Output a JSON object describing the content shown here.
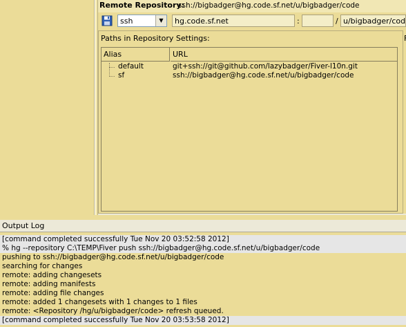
{
  "remote_repository": {
    "label": "Remote Repository:",
    "url": "ssh://bigbadger@hg.code.sf.net/u/bigbadger/code",
    "scheme": "ssh",
    "host": "hg.code.sf.net",
    "port_separator": ":",
    "port": "",
    "path_separator": "/",
    "path": "u/bigbadger/code"
  },
  "paths_panel": {
    "title": "Paths in Repository Settings:",
    "right_label": "F",
    "columns": [
      "Alias",
      "URL"
    ],
    "rows": [
      {
        "alias": "default",
        "url": "git+ssh://git@github.com/lazybadger/Fiver-l10n.git"
      },
      {
        "alias": "sf",
        "url": "ssh://bigbadger@hg.code.sf.net/u/bigbadger/code"
      }
    ]
  },
  "output_log": {
    "title": "Output Log",
    "lines": [
      "[command completed successfully Tue Nov 20 03:52:58 2012]",
      "% hg --repository C:\\TEMP\\Fiver push ssh://bigbadger@hg.code.sf.net/u/bigbadger/code",
      "pushing to ssh://bigbadger@hg.code.sf.net/u/bigbadger/code",
      "searching for changes",
      "remote: adding changesets",
      "remote: adding manifests",
      "remote: adding file changes",
      "remote: added 1 changesets with 1 changes to 1 files",
      "remote: <Repository /hg/u/bigbadger/code> refresh queued.",
      "[command completed successfully Tue Nov 20 03:53:58 2012]"
    ]
  },
  "icons": {
    "save": "save-floppy-icon",
    "dropdown": "dropdown-arrow-icon"
  },
  "colors": {
    "panel_background": "#ebdc98",
    "status_line_background": "#e6e6e6",
    "chrome": "#ece9d8"
  }
}
